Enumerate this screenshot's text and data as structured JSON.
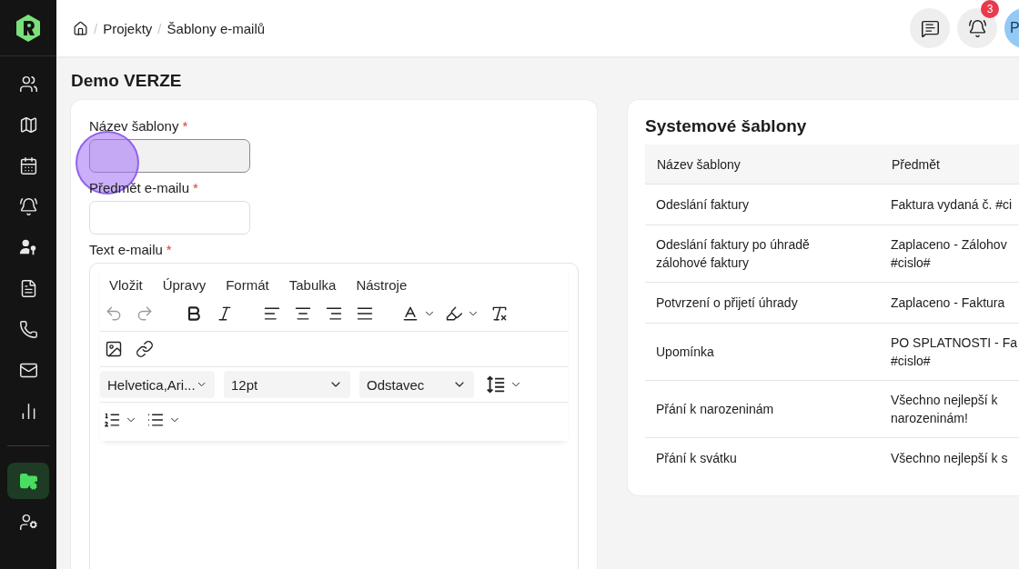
{
  "sidebar": {
    "items": [
      {
        "kind": "users",
        "selected": false
      },
      {
        "kind": "map",
        "selected": false
      },
      {
        "kind": "calendar",
        "selected": false
      },
      {
        "kind": "alarm",
        "selected": false
      },
      {
        "kind": "user-key",
        "selected": false
      },
      {
        "kind": "document",
        "selected": false
      },
      {
        "kind": "phone",
        "selected": false
      },
      {
        "kind": "mail",
        "selected": false
      },
      {
        "kind": "chart",
        "selected": false
      },
      {
        "kind": "divider"
      },
      {
        "kind": "folder",
        "selected": true
      },
      {
        "kind": "user-settings",
        "selected": false
      }
    ]
  },
  "breadcrumb": {
    "separator": "/",
    "items": [
      "Projekty",
      "Šablony e-mailů"
    ]
  },
  "header": {
    "notification_count": "3",
    "avatar": "P"
  },
  "page_title": "Demo VERZE",
  "form": {
    "fields": [
      {
        "label": "Název šablony",
        "required": "*",
        "focused": true
      },
      {
        "label": "Předmět e-mailu",
        "required": "*",
        "focused": false
      }
    ],
    "editor": {
      "label": "Text e-mailu",
      "required": "*",
      "menu": [
        "Vložit",
        "Úpravy",
        "Formát",
        "Tabulka",
        "Nástroje"
      ],
      "font": "Helvetica,Ari...",
      "size": "12pt",
      "block": "Odstavec"
    }
  },
  "templates": {
    "title": "Systemové šablony",
    "columns": [
      "Název šablony",
      "Předmět"
    ],
    "rows": [
      {
        "name": [
          "Odeslání faktury"
        ],
        "subject": [
          "Faktura vydaná č. #ci"
        ]
      },
      {
        "name": [
          "Odeslání faktury po úhradě",
          "zálohové faktury"
        ],
        "subject": [
          "Zaplaceno - Zálohov",
          "#cislo#"
        ]
      },
      {
        "name": [
          "Potvrzení o přijetí úhrady"
        ],
        "subject": [
          "Zaplaceno - Faktura"
        ]
      },
      {
        "name": [
          "Upomínka"
        ],
        "subject": [
          "PO SPLATNOSTI - Fa",
          "#cislo#"
        ]
      },
      {
        "name": [
          "Přání k narozeninám"
        ],
        "subject": [
          "Všechno nejlepší k",
          "narozeninám!"
        ]
      },
      {
        "name": [
          "Přání k svátku"
        ],
        "subject": [
          "Všechno nejlepší k s"
        ]
      }
    ]
  }
}
